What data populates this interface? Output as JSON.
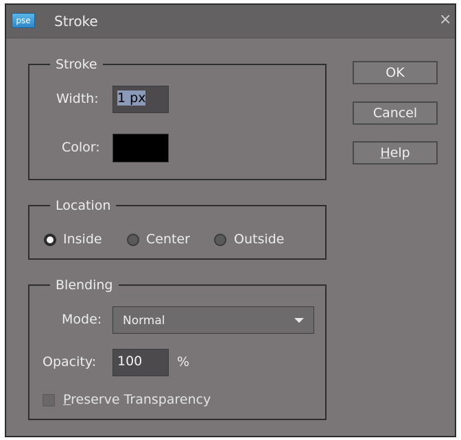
{
  "window": {
    "title": "Stroke",
    "app_icon_text": "pse",
    "close_glyph": "×"
  },
  "stroke": {
    "legend": "Stroke",
    "width_label": "Width:",
    "width_value": "1 px",
    "color_label": "Color:",
    "color_swatch": "#000000"
  },
  "location": {
    "legend": "Location",
    "options": [
      {
        "label": "Inside",
        "selected": true
      },
      {
        "label": "Center",
        "selected": false
      },
      {
        "label": "Outside",
        "selected": false
      }
    ]
  },
  "blending": {
    "legend": "Blending",
    "mode_label": "Mode:",
    "mode_value": "Normal",
    "opacity_label": "Opacity:",
    "opacity_value": "100",
    "opacity_unit": "%",
    "preserve_label": "Preserve Transparency",
    "preserve_checked": false
  },
  "buttons": {
    "ok": "OK",
    "cancel": "Cancel",
    "help": "Help"
  }
}
